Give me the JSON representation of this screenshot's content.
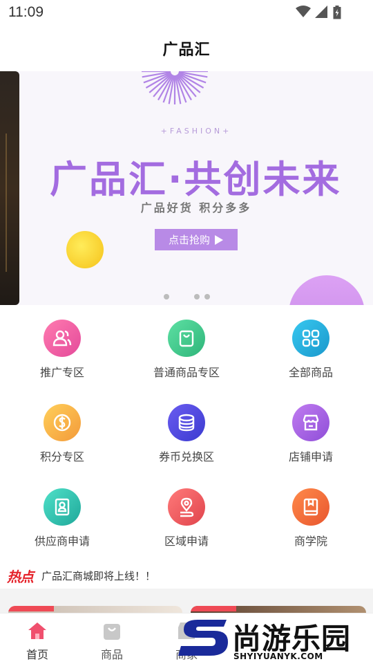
{
  "status_bar": {
    "time": "11:09"
  },
  "app_bar": {
    "title": "广品汇"
  },
  "banner": {
    "tag": "+FASHION+",
    "headline": "广品汇·共创未来",
    "subtitle": "广品好货 积分多多",
    "cta_label": "点击抢购",
    "page_count": 3,
    "active_page": 0
  },
  "menu": [
    {
      "label": "推广专区",
      "icon": "users-icon"
    },
    {
      "label": "普通商品专区",
      "icon": "shopping-bag-icon"
    },
    {
      "label": "全部商品",
      "icon": "grid-icon"
    },
    {
      "label": "积分专区",
      "icon": "coin-icon"
    },
    {
      "label": "券币兑换区",
      "icon": "coin-stack-icon"
    },
    {
      "label": "店铺申请",
      "icon": "store-icon"
    },
    {
      "label": "供应商申请",
      "icon": "id-badge-icon"
    },
    {
      "label": "区域申请",
      "icon": "location-icon"
    },
    {
      "label": "商学院",
      "icon": "book-icon"
    }
  ],
  "news": {
    "tag": "热点",
    "text": "广品汇商城即将上线！！"
  },
  "tabs": [
    {
      "label": "首页",
      "icon": "home-icon",
      "active": true
    },
    {
      "label": "商品",
      "icon": "bag-icon",
      "active": false
    },
    {
      "label": "商家",
      "icon": "shop-icon",
      "active": false
    }
  ],
  "watermark": {
    "title": "尚游乐园",
    "url": "SHYIYUANYK.COM"
  },
  "colors": {
    "banner_purple": "#a36ce0",
    "cta_purple": "#b88ae6",
    "active_tab": "#f0506e",
    "hot_red": "#e5222a"
  }
}
